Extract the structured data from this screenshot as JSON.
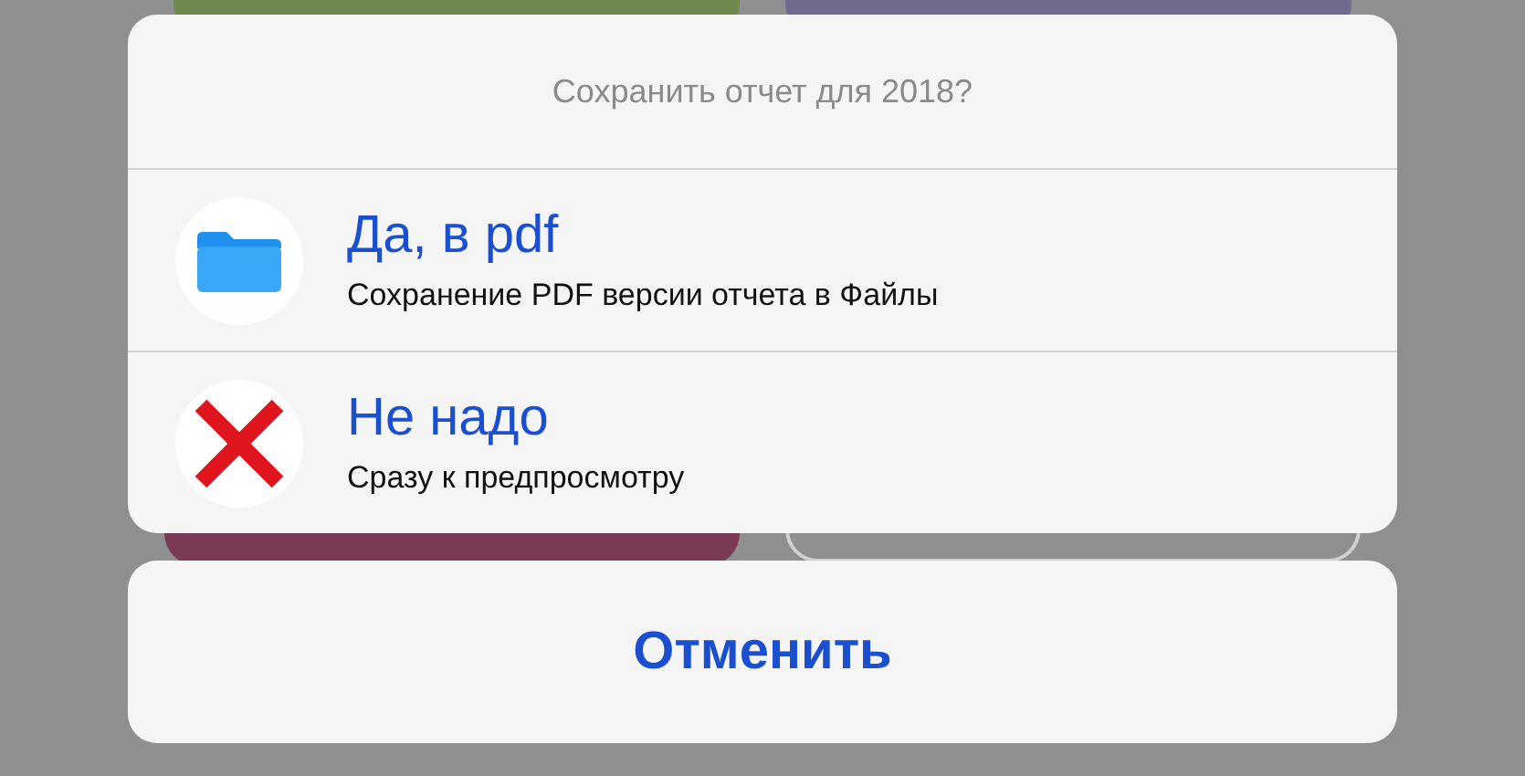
{
  "sheet": {
    "title": "Сохранить отчет для 2018?",
    "options": [
      {
        "kind": "folder",
        "label": "Да, в pdf",
        "description": "Сохранение PDF версии отчета в Файлы"
      },
      {
        "kind": "cross",
        "label": "Не надо",
        "description": "Сразу к предпросмотру"
      }
    ]
  },
  "cancel": "Отменить"
}
